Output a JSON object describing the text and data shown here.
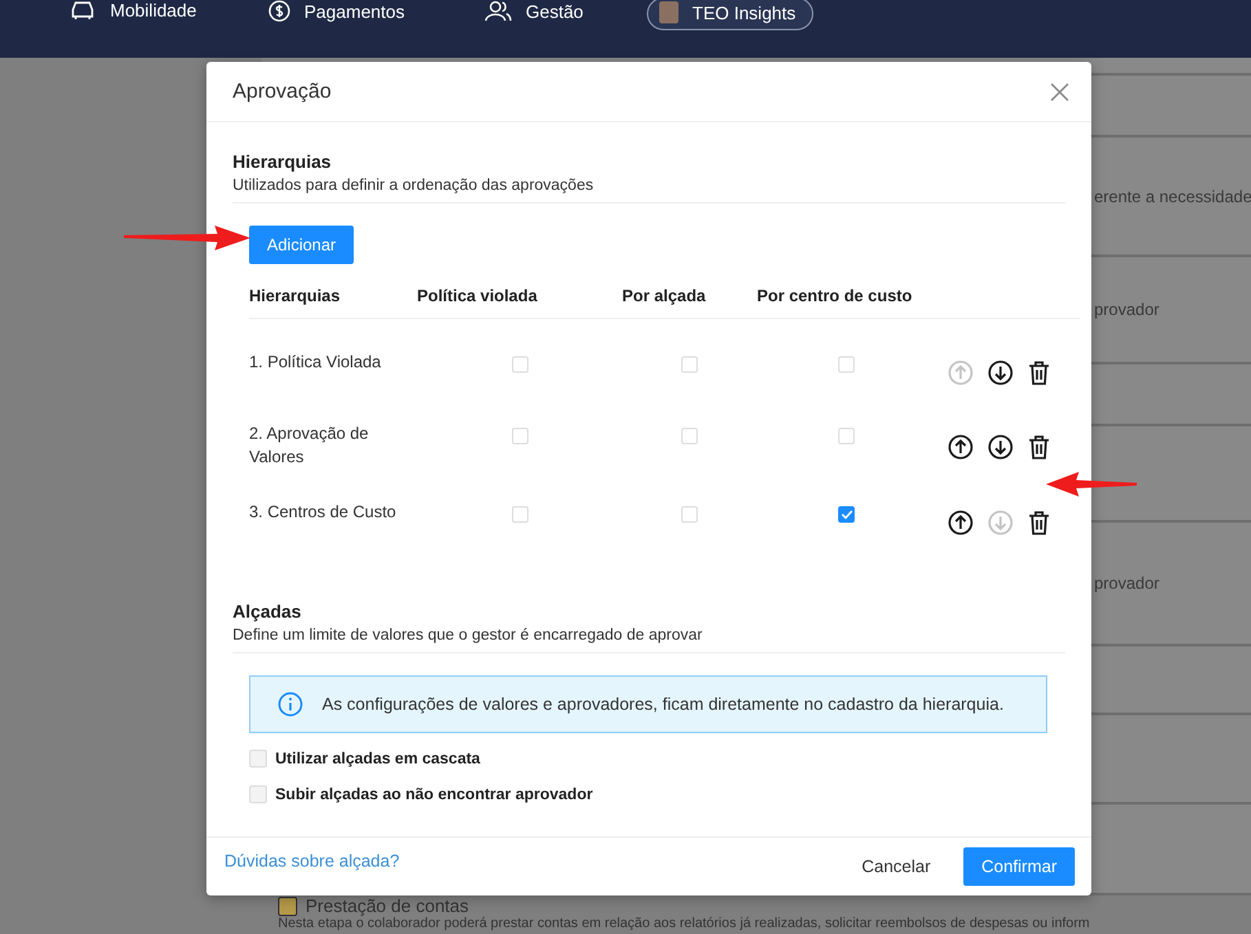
{
  "nav": [
    {
      "label": "Mobilidade",
      "kind": "car",
      "selected": false
    },
    {
      "label": "Pagamentos",
      "kind": "dollar",
      "selected": false
    },
    {
      "label": "Gestão",
      "kind": "people",
      "selected": false
    },
    {
      "label": "TEO Insights",
      "kind": "avatar",
      "selected": true
    }
  ],
  "background": {
    "snippets": [
      "erente a necessidade",
      "provador",
      "provador"
    ],
    "section_title": "Prestação de contas",
    "section_text": "Nesta etapa o colaborador poderá prestar contas em relação aos relatórios já realizadas, solicitar reembolsos de despesas ou inform"
  },
  "dialog": {
    "title": "Aprovação",
    "hierarchies": {
      "title": "Hierarquias",
      "subtitle": "Utilizados para definir a ordenação das aprovações",
      "add_button": "Adicionar",
      "columns": [
        "Hierarquias",
        "Política violada",
        "Por alçada",
        "Por centro de custo"
      ],
      "rows": [
        {
          "name": "1. Política Violada",
          "politica": false,
          "alcada": false,
          "centro": false,
          "up_disabled": true,
          "down_disabled": false
        },
        {
          "name": "2. Aprovação de Valores",
          "politica": false,
          "alcada": false,
          "centro": false,
          "up_disabled": false,
          "down_disabled": false
        },
        {
          "name": "3. Centros de Custo",
          "politica": false,
          "alcada": false,
          "centro": true,
          "up_disabled": false,
          "down_disabled": true
        }
      ]
    },
    "limits": {
      "title": "Alçadas",
      "subtitle": "Define um limite de valores que o gestor é encarregado de aprovar",
      "info": "As configurações de valores e aprovadores, ficam diretamente no cadastro da hierarquia.",
      "options": [
        {
          "label": "Utilizar alçadas em cascata",
          "checked": false
        },
        {
          "label": "Subir alçadas ao não encontrar aprovador",
          "checked": false
        }
      ]
    },
    "help_link": "Dúvidas sobre alçada?",
    "cancel": "Cancelar",
    "confirm": "Confirmar"
  }
}
